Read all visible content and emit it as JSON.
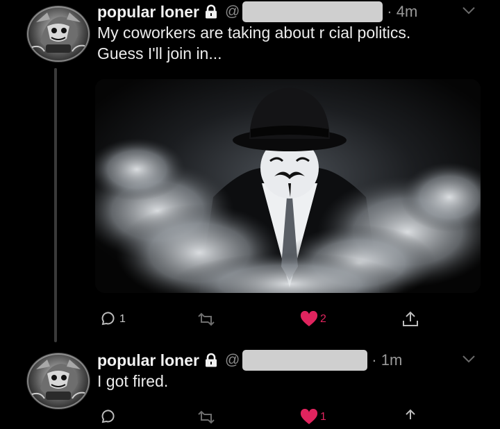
{
  "tweets": [
    {
      "display_name": "popular loner",
      "handle": "@",
      "time": "· 4m",
      "text": "My coworkers are taking about r cial politics.\nGuess I'll join in...",
      "icons": [
        "lock-icon",
        "chevron-down-icon"
      ],
      "has_image": true,
      "actions": {
        "reply_count": "1",
        "retweet_count": "",
        "like_count": "2",
        "liked": true
      }
    },
    {
      "display_name": "popular loner",
      "handle": "@",
      "time": "· 1m",
      "text": "I got fired.",
      "icons": [
        "lock-icon",
        "chevron-down-icon"
      ],
      "has_image": false,
      "actions": {
        "reply_count": "",
        "retweet_count": "",
        "like_count": "1",
        "liked": true
      }
    }
  ],
  "colors": {
    "background": "#000000",
    "text": "#ececec",
    "muted": "#8a8a8a",
    "like": "#e0245e",
    "redaction": "#cfcfcf",
    "thread_line": "#3a3a3a"
  }
}
